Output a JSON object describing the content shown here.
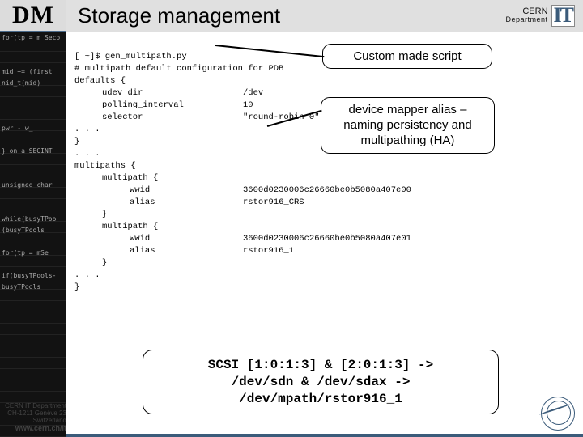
{
  "header": {
    "dm_logo": "DM",
    "title": "Storage management",
    "cern_upper": "CERN",
    "cern_lower": "Department",
    "cern_it": "IT"
  },
  "sidebar": {
    "code_decor": "for(tp = m Seco\n\n\nmid += (first\nnid_t(mid)\n\n\n\npwr - w_\n\n} on a SEGINT\n\n\nunsigned char\n\n\nwhile(busyTPoo\n(busyTPools\n\nfor(tp = mSe\n\nif(busyTPools-\nbusyTPools"
  },
  "block1": {
    "cmd": "[ ~]$ gen_multipath.py",
    "comment": "# multipath default configuration for PDB",
    "defaults_open": "defaults {",
    "udev_key": "udev_dir",
    "udev_val": "/dev",
    "poll_key": "polling_interval",
    "poll_val": "10",
    "sel_key": "selector",
    "sel_val": "\"round-robin 0\"",
    "dots1": ". . .",
    "brace1": "}",
    "dots2": ". . .",
    "multipaths_open": "multipaths {",
    "m1_open": "multipath {",
    "m1_wwid_k": "wwid",
    "m1_wwid_v": "3600d0230006c26660be0b5080a407e00",
    "m1_alias_k": "alias",
    "m1_alias_v": "rstor916_CRS",
    "m1_close": "}",
    "m2_open": "multipath {",
    "m2_wwid_k": "wwid",
    "m2_wwid_v": "3600d0230006c26660be0b5080a407e01",
    "m2_alias_k": "alias",
    "m2_alias_v": "rstor916_1",
    "m2_close": "}",
    "dots3": ". . .",
    "brace_end": "}"
  },
  "callouts": {
    "script": "Custom made script",
    "alias": "device mapper alias – naming persistency and multipathing (HA)"
  },
  "scsi": {
    "line1": "SCSI [1:0:1:3] & [2:0:1:3] ->",
    "line2": "/dev/sdn & /dev/sdax ->",
    "line3": "/dev/mpath/rstor916_1"
  },
  "footer": {
    "dept": "CERN IT Department",
    "addr1": "CH-1211 Genève 23",
    "addr2": "Switzerland",
    "url": "www.cern.ch/it"
  }
}
